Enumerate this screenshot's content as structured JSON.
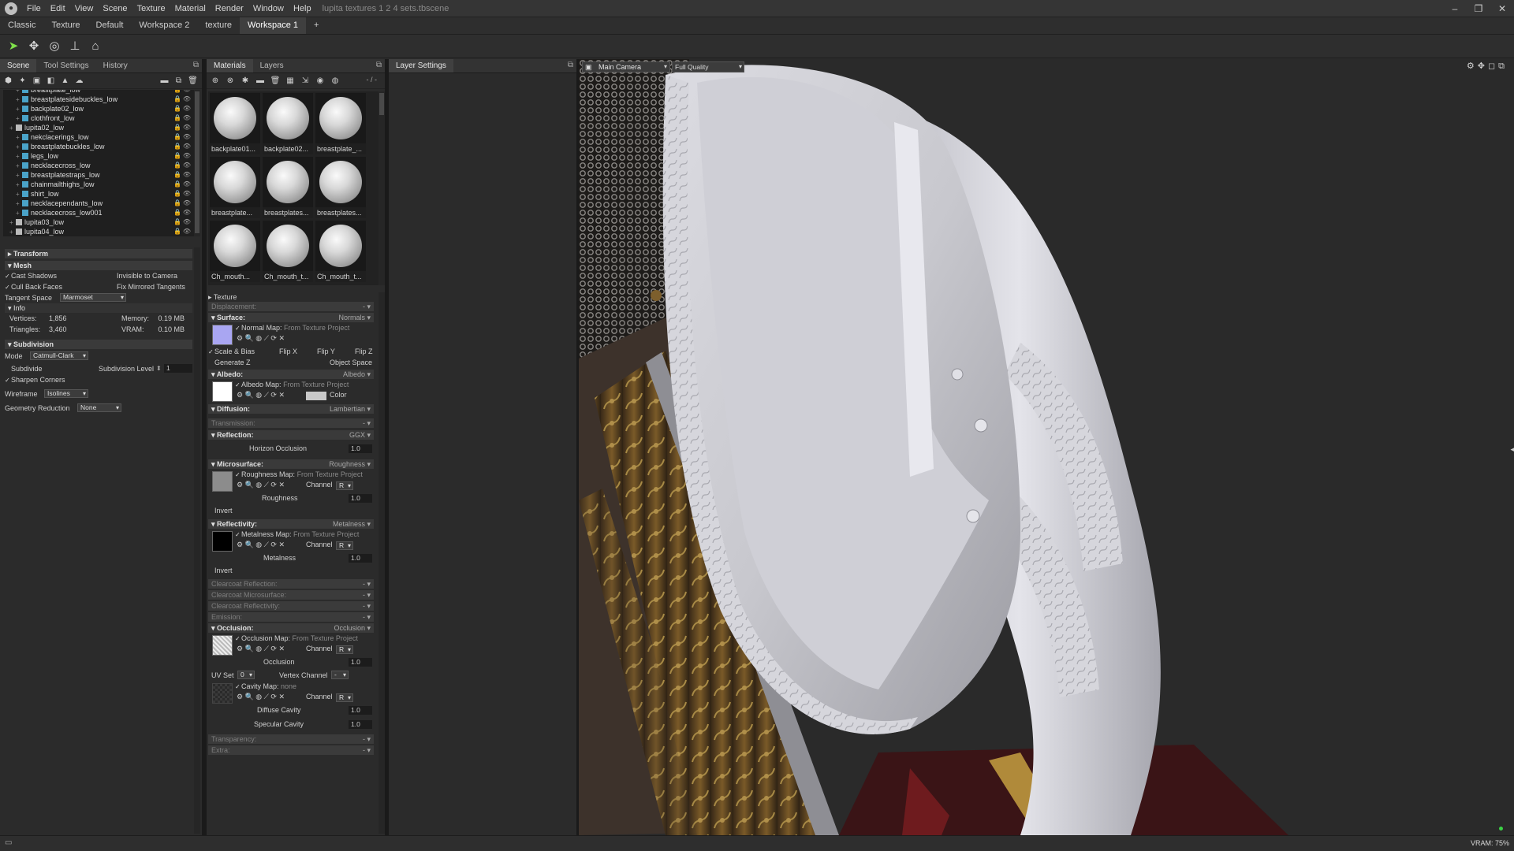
{
  "app": {
    "menu": [
      "File",
      "Edit",
      "View",
      "Scene",
      "Texture",
      "Material",
      "Render",
      "Window",
      "Help"
    ],
    "window_title": "lupita textures 1 2 4 sets.tbscene"
  },
  "workspace_tabs": [
    "Classic",
    "Texture",
    "Default",
    "Workspace 2",
    "texture",
    "Workspace 1",
    "+"
  ],
  "scene_panel": {
    "tabs": [
      "Scene",
      "Tool Settings",
      "History"
    ],
    "tree": [
      {
        "label": "breastplate_low",
        "type": "mesh",
        "indent": 2
      },
      {
        "label": "breastplatesidebuckles_low",
        "type": "mesh",
        "indent": 2
      },
      {
        "label": "backplate02_low",
        "type": "mesh",
        "indent": 2
      },
      {
        "label": "clothfront_low",
        "type": "mesh",
        "indent": 2
      },
      {
        "label": "lupita02_low",
        "type": "group",
        "indent": 1
      },
      {
        "label": "nekclacerings_low",
        "type": "mesh",
        "indent": 2
      },
      {
        "label": "breastplatebuckles_low",
        "type": "mesh",
        "indent": 2
      },
      {
        "label": "legs_low",
        "type": "mesh",
        "indent": 2
      },
      {
        "label": "necklacecross_low",
        "type": "mesh",
        "indent": 2
      },
      {
        "label": "breastplatestraps_low",
        "type": "mesh",
        "indent": 2
      },
      {
        "label": "chainmailthighs_low",
        "type": "mesh",
        "indent": 2
      },
      {
        "label": "shirt_low",
        "type": "mesh",
        "indent": 2
      },
      {
        "label": "necklacependants_low",
        "type": "mesh",
        "indent": 2
      },
      {
        "label": "necklacecross_low001",
        "type": "mesh",
        "indent": 2
      },
      {
        "label": "lupita03_low",
        "type": "group",
        "indent": 1
      },
      {
        "label": "lupita04_low",
        "type": "group",
        "indent": 1
      }
    ],
    "transform_label": "Transform",
    "mesh_label": "Mesh",
    "cast_shadows": "Cast Shadows",
    "invisible_to_camera": "Invisible to Camera",
    "cull_back_faces": "Cull Back Faces",
    "fix_mirrored_tangents": "Fix Mirrored Tangents",
    "tangent_space_label": "Tangent Space",
    "tangent_space_value": "Marmoset",
    "info_label": "Info",
    "vertices_label": "Vertices:",
    "vertices_value": "1,856",
    "triangles_label": "Triangles:",
    "triangles_value": "3,460",
    "memory_label": "Memory:",
    "memory_value": "0.19 MB",
    "vram_label": "VRAM:",
    "vram_value": "0.10 MB",
    "subdivision_label": "Subdivision",
    "mode_label": "Mode",
    "mode_value": "Catmull-Clark",
    "subdivide_label": "Subdivide",
    "subdivision_level_label": "Subdivision Level",
    "subdivision_level_value": "1",
    "sharpen_corners": "Sharpen Corners",
    "wireframe_label": "Wireframe",
    "wireframe_value": "Isolines",
    "geometry_reduction_label": "Geometry Reduction",
    "geometry_reduction_value": "None"
  },
  "materials_panel": {
    "tabs": [
      "Materials",
      "Layers"
    ],
    "counter": "- / -",
    "materials": [
      "backplate01...",
      "backplate02...",
      "breastplate_...",
      "breastplate...",
      "breastplates...",
      "breastplates...",
      "Ch_mouth...",
      "Ch_mouth_t...",
      "Ch_mouth_t..."
    ],
    "texture_label": "Texture",
    "displacement_label": "Displacement:",
    "surface_label": "Surface:",
    "surface_value": "Normals",
    "normal_map_label": "Normal Map:",
    "from_texture_project": "From Texture Project",
    "scale_bias": "Scale & Bias",
    "flip_x": "Flip X",
    "flip_y": "Flip Y",
    "flip_z": "Flip Z",
    "generate_z": "Generate Z",
    "object_space": "Object Space",
    "albedo_label": "Albedo:",
    "albedo_value": "Albedo",
    "albedo_map_label": "Albedo Map:",
    "color_label": "Color",
    "diffusion_label": "Diffusion:",
    "diffusion_value": "Lambertian",
    "transmission_label": "Transmission:",
    "reflection_label": "Reflection:",
    "reflection_value": "GGX",
    "horizon_occlusion_label": "Horizon Occlusion",
    "horizon_occlusion_value": "1.0",
    "microsurface_label": "Microsurface:",
    "microsurface_value": "Roughness",
    "roughness_map_label": "Roughness Map:",
    "channel_label": "Channel",
    "channel_value": "R",
    "roughness_label": "Roughness",
    "roughness_value": "1.0",
    "invert_label": "Invert",
    "reflectivity_label": "Reflectivity:",
    "reflectivity_value": "Metalness",
    "metalness_map_label": "Metalness Map:",
    "metalness_label": "Metalness",
    "metalness_value": "1.0",
    "clearcoat_reflection": "Clearcoat Reflection:",
    "clearcoat_microsurface": "Clearcoat Microsurface:",
    "clearcoat_reflectivity": "Clearcoat Reflectivity:",
    "emission_label": "Emission:",
    "occlusion_label": "Occlusion:",
    "occlusion_value": "Occlusion",
    "occlusion_map_label": "Occlusion Map:",
    "occlusion_field_label": "Occlusion",
    "occlusion_field_value": "1.0",
    "uv_set_label": "UV Set",
    "uv_set_value": "0",
    "vertex_channel_label": "Vertex Channel",
    "vertex_channel_value": "-",
    "cavity_map_label": "Cavity Map:",
    "cavity_map_value": "none",
    "diffuse_cavity_label": "Diffuse Cavity",
    "diffuse_cavity_value": "1.0",
    "specular_cavity_label": "Specular Cavity",
    "specular_cavity_value": "1.0",
    "transparency_label": "Transparency:",
    "extra_label": "Extra:"
  },
  "layer_settings": {
    "tab": "Layer Settings"
  },
  "viewport": {
    "camera": "Main Camera",
    "quality": "Full Quality"
  },
  "status": {
    "vram": "VRAM: 75%"
  }
}
